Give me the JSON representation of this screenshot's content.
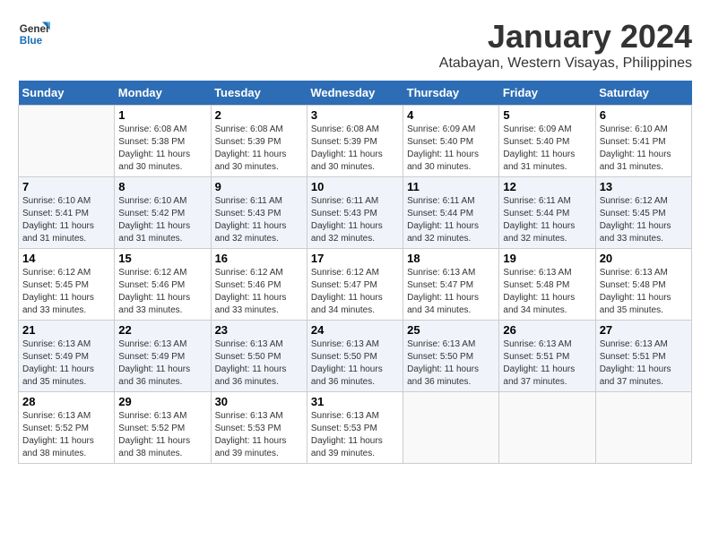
{
  "header": {
    "logo_line1": "General",
    "logo_line2": "Blue",
    "month": "January 2024",
    "location": "Atabayan, Western Visayas, Philippines"
  },
  "weekdays": [
    "Sunday",
    "Monday",
    "Tuesday",
    "Wednesday",
    "Thursday",
    "Friday",
    "Saturday"
  ],
  "weeks": [
    [
      {
        "day": "",
        "info": ""
      },
      {
        "day": "1",
        "info": "Sunrise: 6:08 AM\nSunset: 5:38 PM\nDaylight: 11 hours\nand 30 minutes."
      },
      {
        "day": "2",
        "info": "Sunrise: 6:08 AM\nSunset: 5:39 PM\nDaylight: 11 hours\nand 30 minutes."
      },
      {
        "day": "3",
        "info": "Sunrise: 6:08 AM\nSunset: 5:39 PM\nDaylight: 11 hours\nand 30 minutes."
      },
      {
        "day": "4",
        "info": "Sunrise: 6:09 AM\nSunset: 5:40 PM\nDaylight: 11 hours\nand 30 minutes."
      },
      {
        "day": "5",
        "info": "Sunrise: 6:09 AM\nSunset: 5:40 PM\nDaylight: 11 hours\nand 31 minutes."
      },
      {
        "day": "6",
        "info": "Sunrise: 6:10 AM\nSunset: 5:41 PM\nDaylight: 11 hours\nand 31 minutes."
      }
    ],
    [
      {
        "day": "7",
        "info": "Sunrise: 6:10 AM\nSunset: 5:41 PM\nDaylight: 11 hours\nand 31 minutes."
      },
      {
        "day": "8",
        "info": "Sunrise: 6:10 AM\nSunset: 5:42 PM\nDaylight: 11 hours\nand 31 minutes."
      },
      {
        "day": "9",
        "info": "Sunrise: 6:11 AM\nSunset: 5:43 PM\nDaylight: 11 hours\nand 32 minutes."
      },
      {
        "day": "10",
        "info": "Sunrise: 6:11 AM\nSunset: 5:43 PM\nDaylight: 11 hours\nand 32 minutes."
      },
      {
        "day": "11",
        "info": "Sunrise: 6:11 AM\nSunset: 5:44 PM\nDaylight: 11 hours\nand 32 minutes."
      },
      {
        "day": "12",
        "info": "Sunrise: 6:11 AM\nSunset: 5:44 PM\nDaylight: 11 hours\nand 32 minutes."
      },
      {
        "day": "13",
        "info": "Sunrise: 6:12 AM\nSunset: 5:45 PM\nDaylight: 11 hours\nand 33 minutes."
      }
    ],
    [
      {
        "day": "14",
        "info": "Sunrise: 6:12 AM\nSunset: 5:45 PM\nDaylight: 11 hours\nand 33 minutes."
      },
      {
        "day": "15",
        "info": "Sunrise: 6:12 AM\nSunset: 5:46 PM\nDaylight: 11 hours\nand 33 minutes."
      },
      {
        "day": "16",
        "info": "Sunrise: 6:12 AM\nSunset: 5:46 PM\nDaylight: 11 hours\nand 33 minutes."
      },
      {
        "day": "17",
        "info": "Sunrise: 6:12 AM\nSunset: 5:47 PM\nDaylight: 11 hours\nand 34 minutes."
      },
      {
        "day": "18",
        "info": "Sunrise: 6:13 AM\nSunset: 5:47 PM\nDaylight: 11 hours\nand 34 minutes."
      },
      {
        "day": "19",
        "info": "Sunrise: 6:13 AM\nSunset: 5:48 PM\nDaylight: 11 hours\nand 34 minutes."
      },
      {
        "day": "20",
        "info": "Sunrise: 6:13 AM\nSunset: 5:48 PM\nDaylight: 11 hours\nand 35 minutes."
      }
    ],
    [
      {
        "day": "21",
        "info": "Sunrise: 6:13 AM\nSunset: 5:49 PM\nDaylight: 11 hours\nand 35 minutes."
      },
      {
        "day": "22",
        "info": "Sunrise: 6:13 AM\nSunset: 5:49 PM\nDaylight: 11 hours\nand 36 minutes."
      },
      {
        "day": "23",
        "info": "Sunrise: 6:13 AM\nSunset: 5:50 PM\nDaylight: 11 hours\nand 36 minutes."
      },
      {
        "day": "24",
        "info": "Sunrise: 6:13 AM\nSunset: 5:50 PM\nDaylight: 11 hours\nand 36 minutes."
      },
      {
        "day": "25",
        "info": "Sunrise: 6:13 AM\nSunset: 5:50 PM\nDaylight: 11 hours\nand 36 minutes."
      },
      {
        "day": "26",
        "info": "Sunrise: 6:13 AM\nSunset: 5:51 PM\nDaylight: 11 hours\nand 37 minutes."
      },
      {
        "day": "27",
        "info": "Sunrise: 6:13 AM\nSunset: 5:51 PM\nDaylight: 11 hours\nand 37 minutes."
      }
    ],
    [
      {
        "day": "28",
        "info": "Sunrise: 6:13 AM\nSunset: 5:52 PM\nDaylight: 11 hours\nand 38 minutes."
      },
      {
        "day": "29",
        "info": "Sunrise: 6:13 AM\nSunset: 5:52 PM\nDaylight: 11 hours\nand 38 minutes."
      },
      {
        "day": "30",
        "info": "Sunrise: 6:13 AM\nSunset: 5:53 PM\nDaylight: 11 hours\nand 39 minutes."
      },
      {
        "day": "31",
        "info": "Sunrise: 6:13 AM\nSunset: 5:53 PM\nDaylight: 11 hours\nand 39 minutes."
      },
      {
        "day": "",
        "info": ""
      },
      {
        "day": "",
        "info": ""
      },
      {
        "day": "",
        "info": ""
      }
    ]
  ]
}
